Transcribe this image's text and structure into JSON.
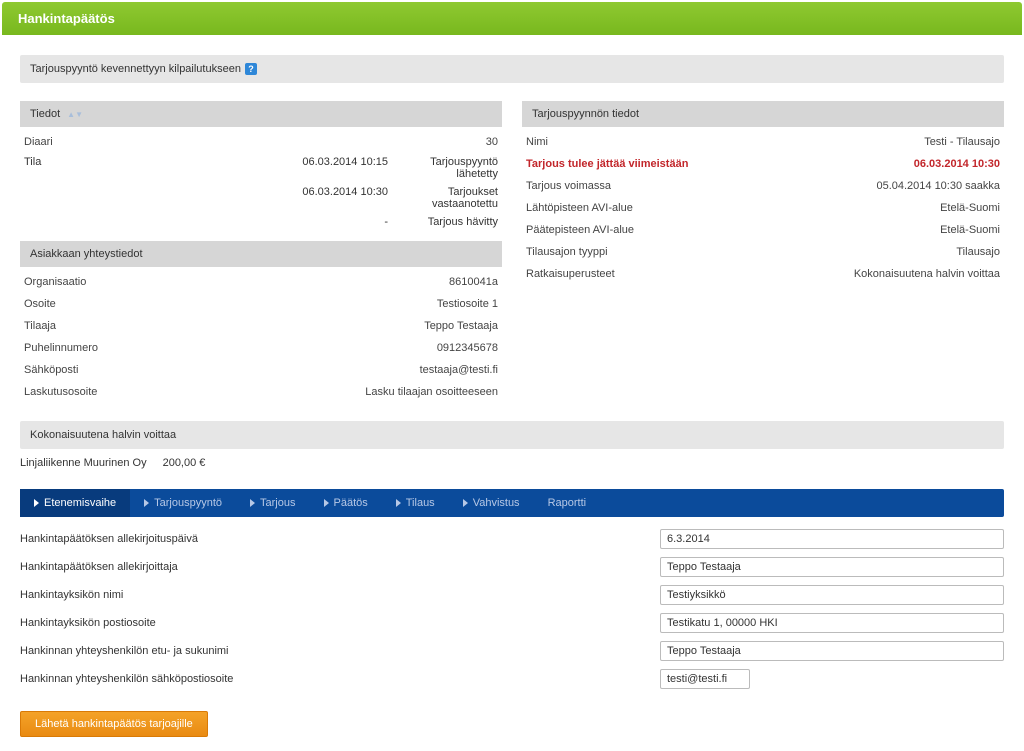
{
  "header": {
    "title": "Hankintapäätös"
  },
  "topbar": {
    "title": "Tarjouspyyntö kevennettyyn kilpailutukseen"
  },
  "left": {
    "tiedot_title": "Tiedot",
    "diaari": {
      "label": "Diaari",
      "value": "30"
    },
    "tila_label": "Tila",
    "tila": [
      {
        "date": "06.03.2014 10:15",
        "status": "Tarjouspyyntö lähetetty"
      },
      {
        "date": "06.03.2014 10:30",
        "status": "Tarjoukset vastaanotettu"
      },
      {
        "date": "-",
        "status": "Tarjous hävitty"
      }
    ],
    "asiakas_title": "Asiakkaan yhteystiedot",
    "asiakas": {
      "org_label": "Organisaatio",
      "org_value": "8610041a",
      "osoite_label": "Osoite",
      "osoite_value": "Testiosoite 1",
      "tilaaja_label": "Tilaaja",
      "tilaaja_value": "Teppo Testaaja",
      "puh_label": "Puhelinnumero",
      "puh_value": "0912345678",
      "sahk_label": "Sähköposti",
      "sahk_value": "testaaja@testi.fi",
      "lasku_label": "Laskutusosoite",
      "lasku_value": "Lasku tilaajan osoitteeseen"
    }
  },
  "right": {
    "title": "Tarjouspyynnön tiedot",
    "rows": {
      "nimi_label": "Nimi",
      "nimi_value": "Testi - Tilausajo",
      "deadline_label": "Tarjous tulee jättää viimeistään",
      "deadline_value": "06.03.2014 10:30",
      "voimassa_label": "Tarjous voimassa",
      "voimassa_value": "05.04.2014 10:30 saakka",
      "lahto_label": "Lähtöpisteen AVI-alue",
      "lahto_value": "Etelä-Suomi",
      "paate_label": "Päätepisteen AVI-alue",
      "paate_value": "Etelä-Suomi",
      "tyyppi_label": "Tilausajon tyyppi",
      "tyyppi_value": "Tilausajo",
      "ratk_label": "Ratkaisuperusteet",
      "ratk_value": "Kokonaisuutena halvin voittaa"
    }
  },
  "winner": {
    "title": "Kokonaisuutena halvin voittaa",
    "name": "Linjaliikenne Muurinen Oy",
    "price": "200,00 €"
  },
  "tabs": [
    {
      "label": "Etenemisvaihe",
      "chev": true
    },
    {
      "label": "Tarjouspyyntö",
      "chev": true
    },
    {
      "label": "Tarjous",
      "chev": true
    },
    {
      "label": "Päätös",
      "chev": true
    },
    {
      "label": "Tilaus",
      "chev": true
    },
    {
      "label": "Vahvistus",
      "chev": true
    },
    {
      "label": "Raportti",
      "chev": false
    }
  ],
  "form": {
    "date_label": "Hankintapäätöksen allekirjoituspäivä",
    "date_value": "6.3.2014",
    "signer_label": "Hankintapäätöksen allekirjoittaja",
    "signer_value": "Teppo Testaaja",
    "unit_label": "Hankintayksikön nimi",
    "unit_value": "Testiyksikkö",
    "addr_label": "Hankintayksikön postiosoite",
    "addr_value": "Testikatu 1, 00000 HKI",
    "person_label": "Hankinnan yhteyshenkilön etu- ja sukunimi",
    "person_value": "Teppo Testaaja",
    "email_label": "Hankinnan yhteyshenkilön sähköpostiosoite",
    "email_value": "testi@testi.fi",
    "send_button": "Lähetä hankintapäätös tarjoajille"
  }
}
